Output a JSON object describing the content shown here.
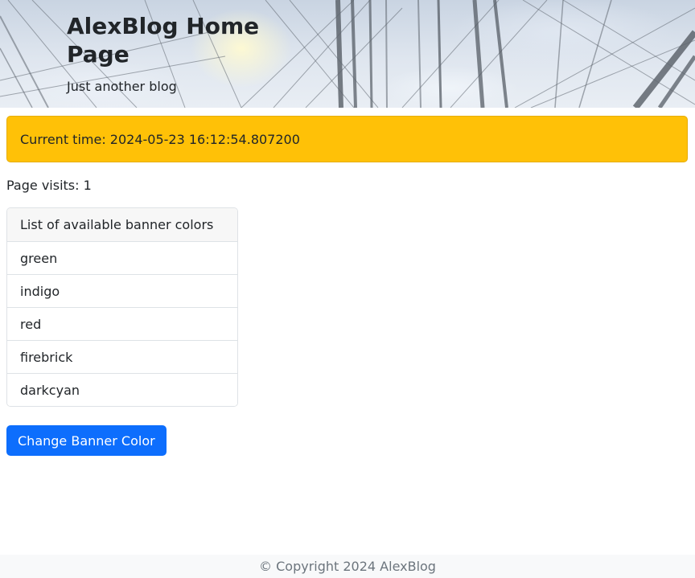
{
  "header": {
    "title": "AlexBlog Home Page",
    "tagline": "Just another blog"
  },
  "alert": {
    "text": "Current time: 2024-05-23 16:12:54.807200"
  },
  "visits": {
    "text": "Page visits: 1"
  },
  "color_list": {
    "header": "List of available banner colors",
    "items": [
      "green",
      "indigo",
      "red",
      "firebrick",
      "darkcyan"
    ]
  },
  "button": {
    "label": "Change Banner Color"
  },
  "footer": {
    "text": "© Copyright 2024 AlexBlog"
  },
  "colors": {
    "alert_bg": "#ffc107",
    "button_bg": "#0d6efd",
    "footer_bg": "#f8f9fa"
  }
}
